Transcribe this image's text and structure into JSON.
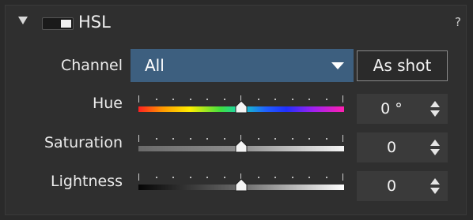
{
  "panel": {
    "title": "HSL",
    "help": "?",
    "enabled": true
  },
  "channel": {
    "label": "Channel",
    "selected": "All",
    "as_shot_label": "As shot"
  },
  "sliders": [
    {
      "label": "Hue",
      "value": "0 °",
      "level": 0.5,
      "gradient": "hue"
    },
    {
      "label": "Saturation",
      "value": "0",
      "level": 0.5,
      "gradient": "saturation"
    },
    {
      "label": "Lightness",
      "value": "0",
      "level": 0.5,
      "gradient": "lightness"
    }
  ],
  "colors": {
    "select_bg": "#3d5f7f",
    "panel_bg": "#2f2f2f",
    "field_bg": "#3a3a3a"
  }
}
